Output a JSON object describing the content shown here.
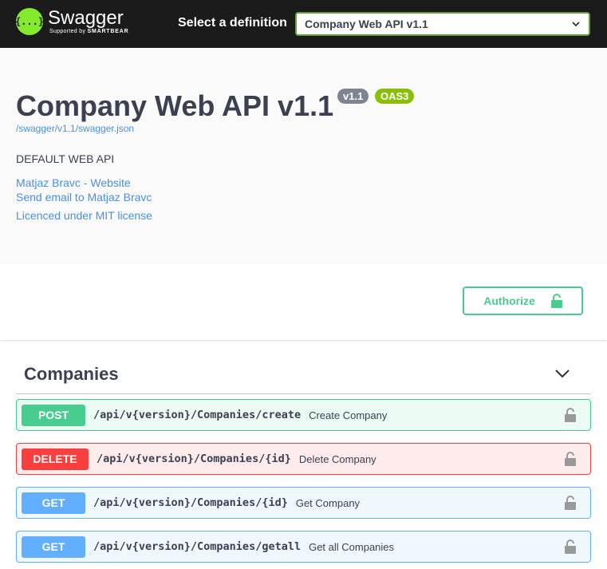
{
  "topbar": {
    "logo_glyph": "{...}",
    "logo_name": "Swagger",
    "logo_sub_prefix": "Supported by",
    "logo_sub_brand": "SMARTBEAR",
    "definition_label": "Select a definition",
    "definition_selected": "Company Web API v1.1",
    "accent_color": "#85ea2d"
  },
  "info": {
    "title": "Company Web API v1.1",
    "version_badge": "v1.1",
    "oas_badge": "OAS3",
    "spec_url": "/swagger/v1.1/swagger.json",
    "description": "DEFAULT WEB API",
    "contact_website": "Matjaz Bravc - Website",
    "contact_email": "Send email to Matjaz Bravc",
    "license": "Licenced under MIT license"
  },
  "auth": {
    "button_label": "Authorize",
    "icon": "unlocked-padlock-icon"
  },
  "tag": {
    "name": "Companies",
    "toggle_icon": "chevron-down-icon"
  },
  "operations": [
    {
      "method": "POST",
      "path": "/api/v{version}/Companies/create",
      "summary": "Create Company",
      "color": "#49cc90"
    },
    {
      "method": "DELETE",
      "path": "/api/v{version}/Companies/{id}",
      "summary": "Delete Company",
      "color": "#f93e3e"
    },
    {
      "method": "GET",
      "path": "/api/v{version}/Companies/{id}",
      "summary": "Get Company",
      "color": "#61affe"
    },
    {
      "method": "GET",
      "path": "/api/v{version}/Companies/getall",
      "summary": "Get all Companies",
      "color": "#61affe"
    }
  ]
}
